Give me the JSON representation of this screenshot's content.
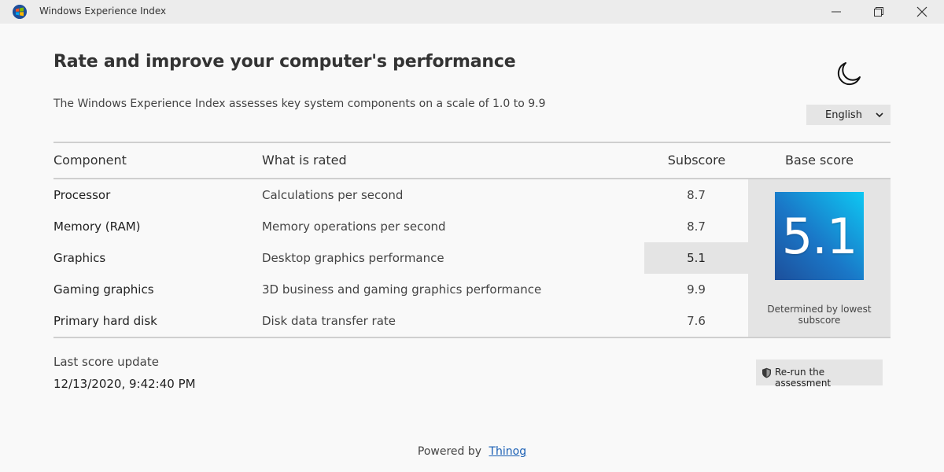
{
  "window": {
    "title": "Windows Experience Index",
    "controls": [
      "minimize-icon",
      "restore-icon",
      "close-icon"
    ]
  },
  "header": {
    "title": "Rate and improve your computer's performance",
    "subtitle": "The Windows Experience Index assesses key system components on a scale of 1.0 to 9.9",
    "theme_icon": "moon-icon",
    "language": {
      "selected": "English"
    }
  },
  "table": {
    "columns": {
      "component": "Component",
      "rated": "What is rated",
      "subscore": "Subscore",
      "base": "Base score"
    },
    "rows": [
      {
        "component": "Processor",
        "rated": "Calculations per second",
        "subscore": "8.7"
      },
      {
        "component": "Memory (RAM)",
        "rated": "Memory operations per second",
        "subscore": "8.7"
      },
      {
        "component": "Graphics",
        "rated": "Desktop graphics performance",
        "subscore": "5.1"
      },
      {
        "component": "Gaming graphics",
        "rated": "3D business and gaming graphics performance",
        "subscore": "9.9"
      },
      {
        "component": "Primary hard disk",
        "rated": "Disk data transfer rate",
        "subscore": "7.6"
      }
    ],
    "highlighted_row": "Graphics"
  },
  "base_score": {
    "value": "5.1",
    "caption": "Determined by lowest subscore"
  },
  "last_update": {
    "label": "Last score update",
    "value": "12/13/2020, 9:42:40 PM"
  },
  "rerun": {
    "label": "Re-run the assessment",
    "icon": "shield-icon"
  },
  "footer": {
    "prefix": "Powered by",
    "link": "Thinog"
  },
  "colors": {
    "tile_start": "#1d4f9b",
    "tile_end": "#0ec8f3",
    "panel": "#e4e4e4",
    "link": "#1a5fb4"
  }
}
